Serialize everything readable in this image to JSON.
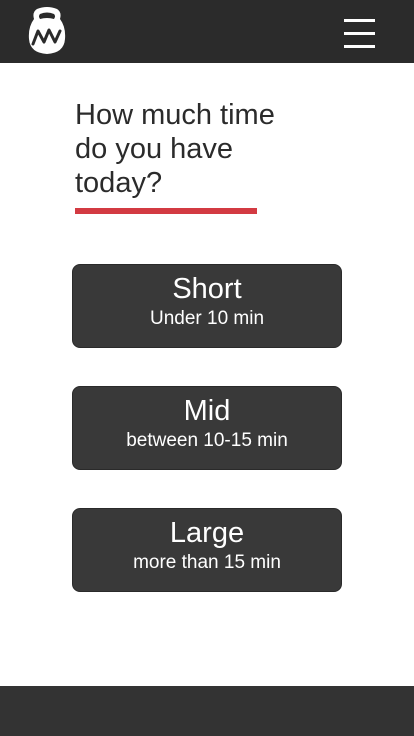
{
  "header": {
    "logo_icon": "kettlebell-logo-icon",
    "menu_icon": "hamburger-menu-icon"
  },
  "question": {
    "line1": "How much time",
    "line2": "do you have",
    "line3": "today?",
    "underline_color": "#d33a42"
  },
  "options": [
    {
      "title": "Short",
      "subtitle": "Under 10 min"
    },
    {
      "title": "Mid",
      "subtitle": "between 10-15 min"
    },
    {
      "title": "Large",
      "subtitle": "more than 15 min"
    }
  ],
  "colors": {
    "header_bg": "#2b2b2b",
    "button_bg": "#393939",
    "accent": "#d33a42",
    "footer_bg": "#333333"
  }
}
